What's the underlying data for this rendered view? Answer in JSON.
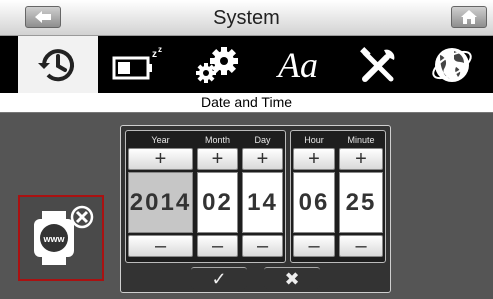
{
  "header": {
    "title": "System"
  },
  "tabs": [
    {
      "icon": "clock-history-icon",
      "active": true
    },
    {
      "icon": "battery-sleep-icon"
    },
    {
      "icon": "gears-icon"
    },
    {
      "icon": "font-aa-icon",
      "text": "Aa"
    },
    {
      "icon": "tools-icon"
    },
    {
      "icon": "globe-icon"
    }
  ],
  "section": {
    "title": "Date and Time"
  },
  "picker": {
    "date": [
      {
        "label": "Year",
        "value": "2014",
        "selected": true
      },
      {
        "label": "Month",
        "value": "02"
      },
      {
        "label": "Day",
        "value": "14"
      }
    ],
    "time": [
      {
        "label": "Hour",
        "value": "06"
      },
      {
        "label": "Minute",
        "value": "25"
      }
    ],
    "increment": "+",
    "decrement": "–",
    "confirm": "✓",
    "cancel": "✖"
  },
  "side_icon": "watch-www-sync-icon",
  "colors": {
    "selected_border": "#aa1111",
    "body_bg": "#555555"
  }
}
